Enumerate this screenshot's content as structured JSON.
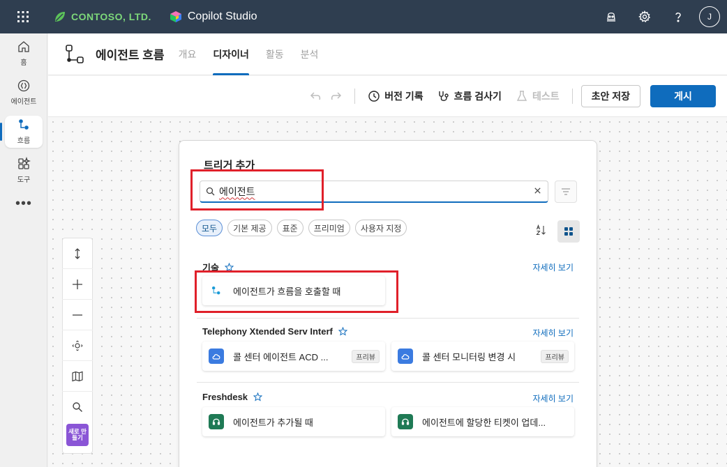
{
  "topbar": {
    "brand": "CONTOSO, LTD.",
    "product": "Copilot Studio",
    "avatar_initial": "J",
    "icons": [
      "waffle-icon",
      "copilot-icon",
      "settings-icon",
      "help-icon"
    ]
  },
  "rail": {
    "items": [
      {
        "label": "홈",
        "icon": "home-icon"
      },
      {
        "label": "에이전트",
        "icon": "agent-icon"
      },
      {
        "label": "흐름",
        "icon": "flow-icon"
      },
      {
        "label": "도구",
        "icon": "tools-icon"
      }
    ],
    "more": "•••"
  },
  "header": {
    "title": "에이전트 흐름",
    "tabs": [
      {
        "label": "개요",
        "active": false
      },
      {
        "label": "디자이너",
        "active": true
      },
      {
        "label": "활동",
        "active": false
      },
      {
        "label": "분석",
        "active": false
      }
    ]
  },
  "toolbar": {
    "version_history": "버전 기록",
    "flow_checker": "흐름 검사기",
    "test": "테스트",
    "save_draft": "초안 저장",
    "publish": "게시"
  },
  "zoom": {
    "new_badge": "새로 만들기"
  },
  "panel": {
    "title": "트리거 추가",
    "search_value": "에이전트",
    "chips": [
      {
        "label": "모두",
        "active": true
      },
      {
        "label": "기본 제공",
        "active": false
      },
      {
        "label": "표준",
        "active": false
      },
      {
        "label": "프리미엄",
        "active": false
      },
      {
        "label": "사용자 지정",
        "active": false
      }
    ],
    "sections": [
      {
        "name": "기술",
        "see_more": "자세히 보기",
        "cards": [
          {
            "label": "에이전트가 흐름을 호출할 때",
            "badge": ""
          }
        ]
      },
      {
        "name": "Telephony Xtended Serv Interf",
        "see_more": "자세히 보기",
        "cards": [
          {
            "label": "콜 센터 에이전트 ACD ...",
            "badge": "프리뷰"
          },
          {
            "label": "콜 센터 모니터링 변경 시",
            "badge": "프리뷰"
          }
        ]
      },
      {
        "name": "Freshdesk",
        "see_more": "자세히 보기",
        "cards": [
          {
            "label": "에이전트가 추가될 때",
            "badge": ""
          },
          {
            "label": "에이전트에 할당한 티켓이 업데...",
            "badge": ""
          }
        ]
      }
    ]
  },
  "colors": {
    "accent": "#0f6cbd",
    "topbar": "#2f3e50",
    "highlight": "#e0202a",
    "new_badge": "#8a55d6"
  }
}
